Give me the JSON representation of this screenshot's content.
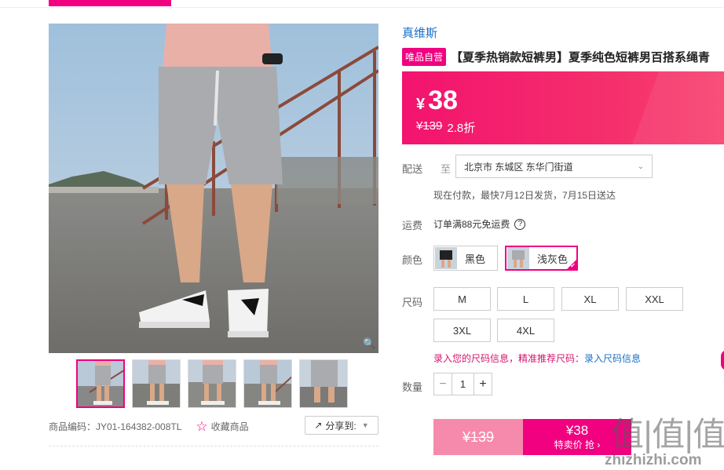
{
  "product": {
    "brand": "真维斯",
    "badge": "唯品自营",
    "title": "【夏季热销款短裤男】夏季纯色短裤男百搭系绳青"
  },
  "price": {
    "currency": "¥",
    "current": "38",
    "original": "¥139",
    "discount": "2.8折"
  },
  "delivery": {
    "label": "配送",
    "to": "至",
    "address": "北京市 东城区 东华门街道",
    "note": "现在付款，最快7月12日发货，7月15日送达"
  },
  "freight": {
    "label": "运费",
    "text": "订单满88元免运费",
    "help_icon": "?"
  },
  "color": {
    "label": "颜色",
    "options": [
      {
        "name": "黑色",
        "selected": false
      },
      {
        "name": "浅灰色",
        "selected": true
      }
    ]
  },
  "size": {
    "label": "尺码",
    "options": [
      "M",
      "L",
      "XL",
      "XXL",
      "3XL",
      "4XL"
    ],
    "tip": "录入您的尺码信息，精准推荐尺码：",
    "tip_link": "录入尺码信息"
  },
  "quantity": {
    "label": "数量",
    "minus": "−",
    "value": "1",
    "plus": "+"
  },
  "buy": {
    "original": "¥139",
    "price": "¥38",
    "action": "特卖价 抢 ›"
  },
  "gallery": {
    "product_code": "商品编码：JY01-164382-008TL",
    "favorite": "收藏商品",
    "share": "分享到:",
    "zoom_icon": "magnifier-icon"
  },
  "watermark": {
    "glyphs": "值|值|值",
    "site": "zhizhizhi.com"
  },
  "colors": {
    "accent": "#f10180",
    "link": "#1a6fc9",
    "price_bg": "#f3136f"
  }
}
